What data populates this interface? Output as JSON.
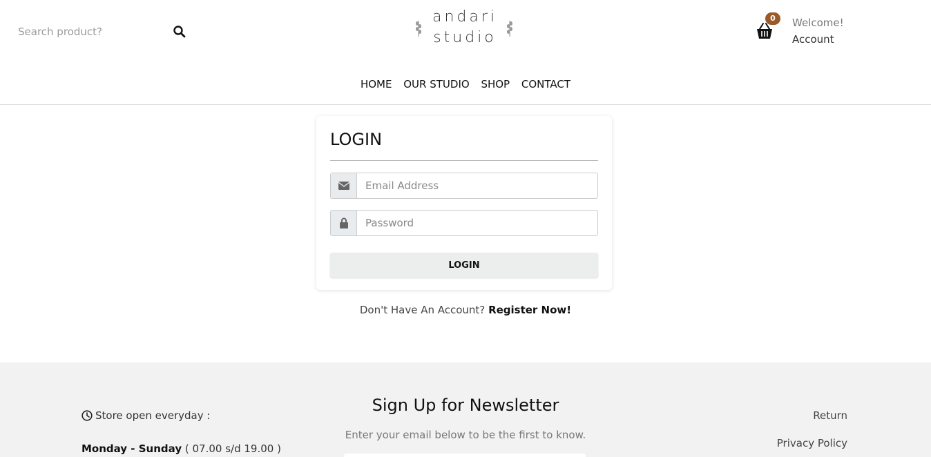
{
  "header": {
    "search_placeholder": "Search product?",
    "logo_line1": "andari",
    "logo_line2": "studio",
    "cart_count": "0",
    "welcome": "Welcome!",
    "account": "Account",
    "nav": [
      "HOME",
      "OUR STUDIO",
      "SHOP",
      "CONTACT"
    ]
  },
  "login": {
    "title": "LOGIN",
    "email_placeholder": "Email Address",
    "password_placeholder": "Password",
    "button": "LOGIN",
    "no_account": "Don't Have An Account?",
    "register": "Register Now!"
  },
  "footer": {
    "store_open": "Store open everyday :",
    "days": "Monday - Sunday",
    "hours": "( 07.00 s/d 19.00 )",
    "newsletter_title": "Sign Up for Newsletter",
    "newsletter_sub": "Enter your email below to be the first to know.",
    "links": [
      "Return",
      "Privacy Policy"
    ]
  },
  "icons": {
    "search": "search-icon",
    "cart": "basket-icon",
    "email": "envelope-icon",
    "lock": "lock-icon",
    "clock": "clock-icon"
  },
  "colors": {
    "badge": "#9a5a2a",
    "footer_bg": "#f2f2f2"
  }
}
